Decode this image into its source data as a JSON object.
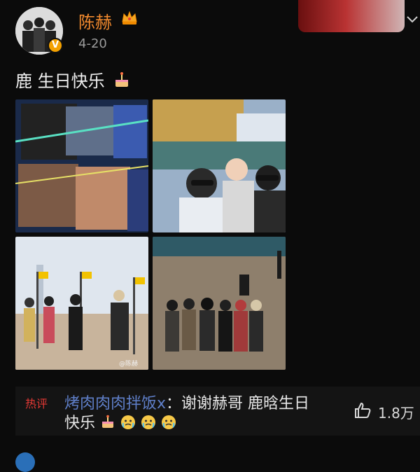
{
  "header": {
    "username": "陈赫",
    "date": "4-20",
    "verified_badge": "V",
    "colors": {
      "username": "#f28a2e",
      "verified": "#f4a100",
      "link": "#5f7fc9"
    },
    "icons": [
      "crown-icon",
      "more-chevron-icon",
      "verified-badge-icon"
    ]
  },
  "post": {
    "text": "鹿 生日快乐",
    "emoji": "birthday-cake-icon",
    "photo_watermark": "@陈赫"
  },
  "comment": {
    "badge": "热评",
    "user": "烤肉肉肉拌饭x",
    "separator": "：",
    "text_line1": "谢谢赫哥 鹿晗生日",
    "text_line2": "快乐",
    "emojis": [
      "birthday-cake-icon",
      "crying-face-icon",
      "crying-face-icon",
      "crying-face-icon"
    ],
    "like_icon": "thumbs-up-icon",
    "like_count": "1.8万"
  }
}
